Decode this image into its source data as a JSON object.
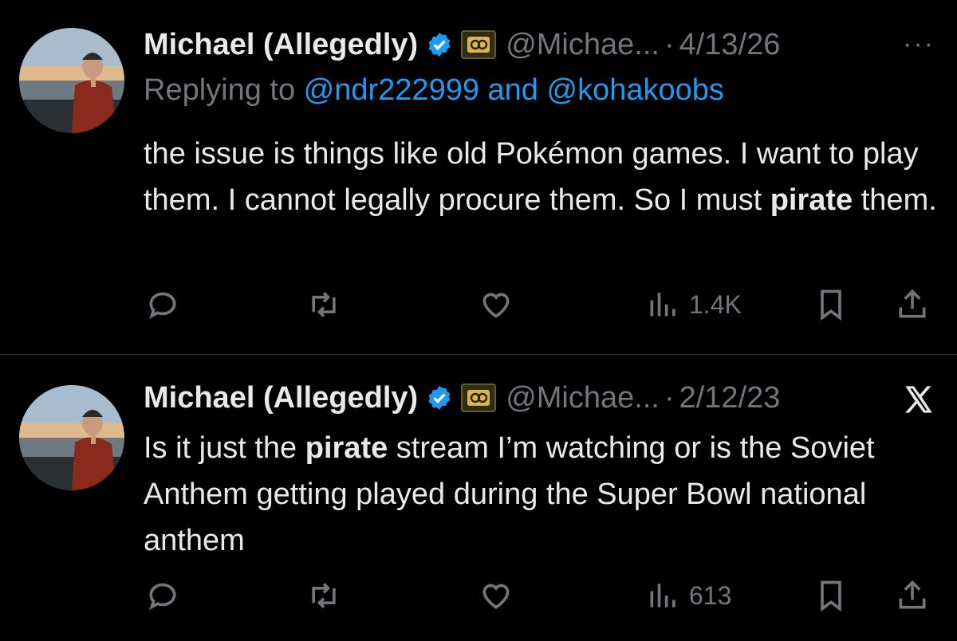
{
  "tweets": [
    {
      "author_name": "Michael (Allegedly)",
      "handle": "@Michae...",
      "separator": "·",
      "date": "4/13/26",
      "more": "···",
      "replying_to_prefix": "Replying to ",
      "replying_to_mentions": "@ndr222999 and @kohakoobs",
      "text_before": "the issue is things like old Pokémon games. I want to play them. I cannot legally procure them. So I must ",
      "text_bold": "pirate",
      "text_after": " them.",
      "views": "1.4K"
    },
    {
      "author_name": "Michael (Allegedly)",
      "handle": "@Michae...",
      "separator": "·",
      "date": "2/12/23",
      "text_before": "Is it just the ",
      "text_bold": "pirate",
      "text_after": " stream I’m watching or is the Soviet Anthem getting played during the Super Bowl national anthem",
      "views": "613"
    }
  ],
  "icons": {
    "verified": "verified-badge-icon",
    "affiliate": "affiliate-badge-icon",
    "reply": "reply-icon",
    "retweet": "retweet-icon",
    "like": "like-icon",
    "views": "views-icon",
    "bookmark": "bookmark-icon",
    "share": "share-icon",
    "x_logo": "x-logo-icon"
  },
  "colors": {
    "background": "#000000",
    "text": "#e7e9ea",
    "muted": "#71767b",
    "accent": "#1d9bf0",
    "divider": "#2f3336"
  }
}
